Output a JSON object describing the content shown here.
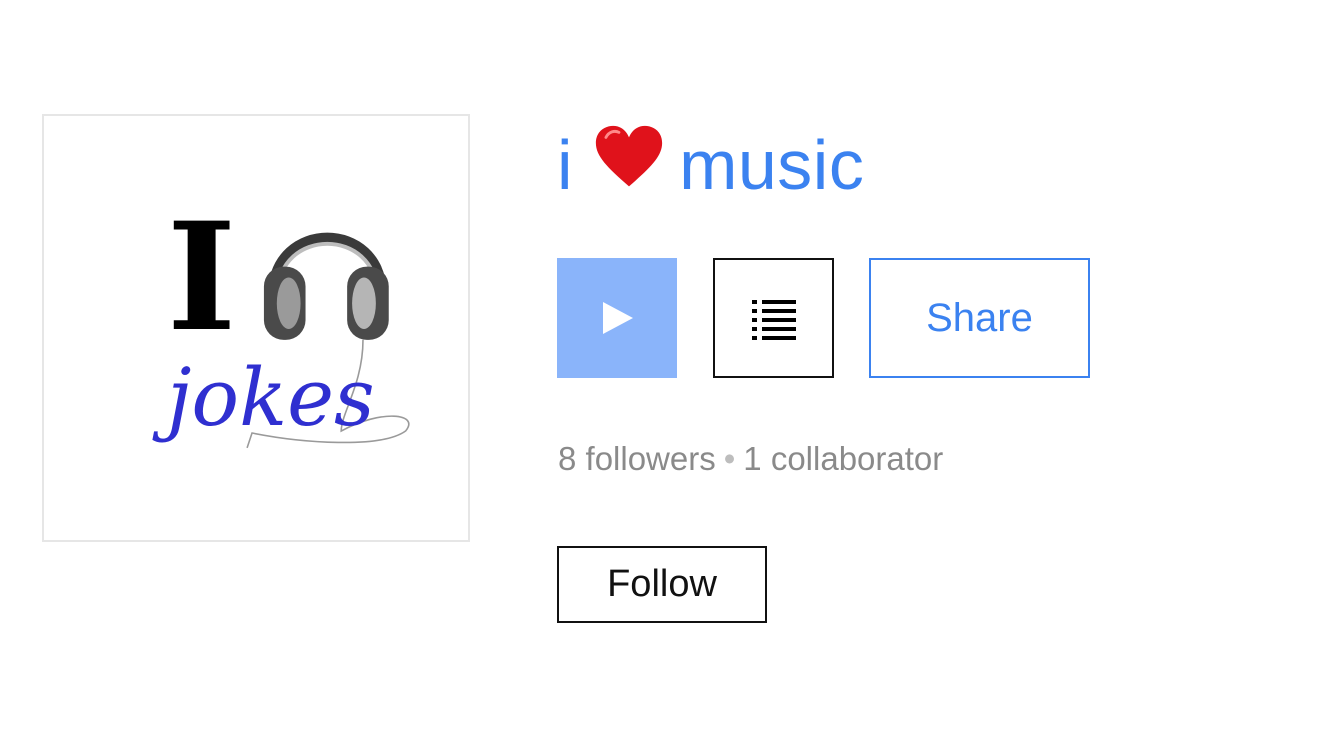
{
  "playlist": {
    "title_prefix": "i",
    "title_suffix": "music",
    "title_emoji": "heart",
    "cover": {
      "big_letter": "I",
      "word": "jokes",
      "icon": "headphones-icon"
    }
  },
  "actions": {
    "play_icon": "play-icon",
    "queue_icon": "list-icon",
    "share_label": "Share",
    "follow_label": "Follow"
  },
  "stats": {
    "followers": "8 followers",
    "separator": "•",
    "collaborators": "1 collaborator"
  },
  "colors": {
    "accent": "#3b82f0",
    "play_bg": "#8ab4fa",
    "heart": "#e0121b",
    "muted_text": "#8a8a8a",
    "cover_word": "#2f2fd0"
  }
}
